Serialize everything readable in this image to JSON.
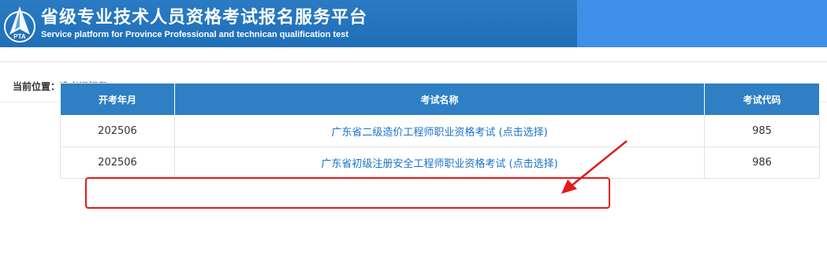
{
  "header": {
    "title_cn": "省级专业技术人员资格考试报名服务平台",
    "title_en": "Service platform for Province Professional and technican qualification test",
    "logo_text": "PTA"
  },
  "breadcrumb": "当前位置：准考证打印",
  "table": {
    "headers": [
      "开考年月",
      "考试名称",
      "考试代码"
    ],
    "rows": [
      {
        "date": "202506",
        "name": "广东省二级造价工程师职业资格考试 (点击选择)",
        "code": "985"
      },
      {
        "date": "202506",
        "name": "广东省初级注册安全工程师职业资格考试 (点击选择)",
        "code": "986"
      }
    ]
  },
  "colors": {
    "header_bg": "#1f6fb8",
    "table_header_bg": "#2e7fc4",
    "link": "#1a73c9",
    "annotation": "#e21a1a"
  }
}
